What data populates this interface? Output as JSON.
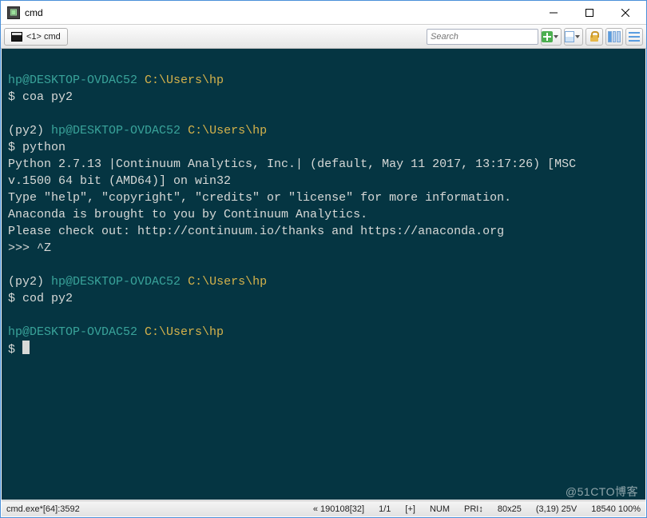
{
  "window": {
    "title": "cmd"
  },
  "tab": {
    "label": "<1> cmd"
  },
  "search": {
    "placeholder": "Search"
  },
  "terminal": {
    "blocks": [
      {
        "env": "",
        "userhost": "hp@DESKTOP-OVDAC52",
        "path": "C:\\Users\\hp",
        "prompt": "$",
        "command": "coa py2",
        "output": []
      },
      {
        "env": "(py2)",
        "userhost": "hp@DESKTOP-OVDAC52",
        "path": "C:\\Users\\hp",
        "prompt": "$",
        "command": "python",
        "output": [
          "Python 2.7.13 |Continuum Analytics, Inc.| (default, May 11 2017, 13:17:26) [MSC",
          "v.1500 64 bit (AMD64)] on win32",
          "Type \"help\", \"copyright\", \"credits\" or \"license\" for more information.",
          "Anaconda is brought to you by Continuum Analytics.",
          "Please check out: http://continuum.io/thanks and https://anaconda.org",
          ">>> ^Z"
        ]
      },
      {
        "env": "(py2)",
        "userhost": "hp@DESKTOP-OVDAC52",
        "path": "C:\\Users\\hp",
        "prompt": "$",
        "command": "cod py2",
        "output": []
      },
      {
        "env": "",
        "userhost": "hp@DESKTOP-OVDAC52",
        "path": "C:\\Users\\hp",
        "prompt": "$",
        "command": "",
        "output": []
      }
    ]
  },
  "statusbar": {
    "left": "cmd.exe*[64]:3592",
    "history": "« 190108[32]",
    "pos": "1/1",
    "plus": "[+]",
    "num": "NUM",
    "pri": "PRI↕",
    "size": "80x25",
    "cursor": "(3,19) 25V",
    "right": "18540 100%"
  },
  "watermark": "@51CTO博客"
}
